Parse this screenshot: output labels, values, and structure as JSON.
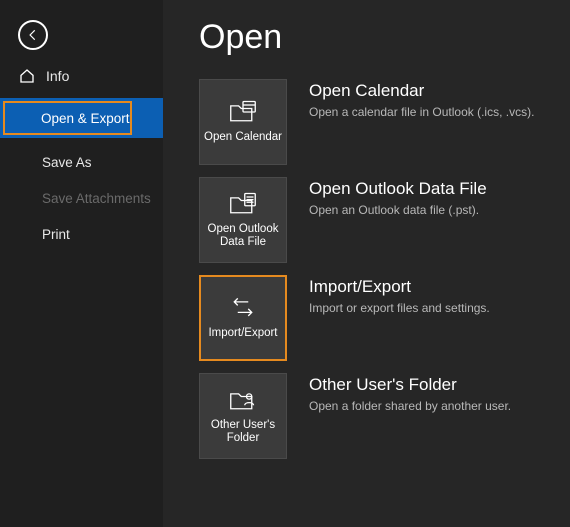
{
  "sidebar": {
    "info": "Info",
    "open_export": "Open & Export",
    "save_as": "Save As",
    "save_attachments": "Save Attachments",
    "print": "Print"
  },
  "page": {
    "title": "Open"
  },
  "tiles": [
    {
      "label": "Open Calendar",
      "title": "Open Calendar",
      "desc": "Open a calendar file in Outlook (.ics, .vcs)."
    },
    {
      "label": "Open Outlook Data File",
      "title": "Open Outlook Data File",
      "desc": "Open an Outlook data file (.pst)."
    },
    {
      "label": "Import/Export",
      "title": "Import/Export",
      "desc": "Import or export files and settings."
    },
    {
      "label": "Other User's Folder",
      "title": "Other User's Folder",
      "desc": "Open a folder shared by another user."
    }
  ]
}
